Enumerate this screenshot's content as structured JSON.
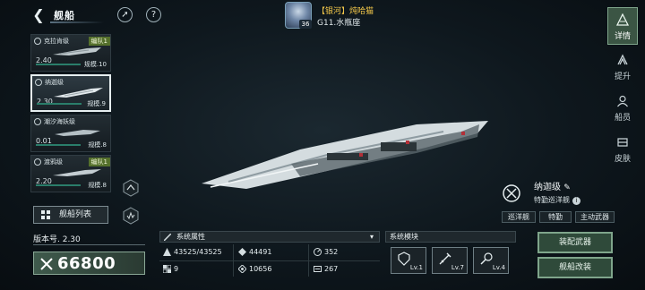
{
  "header": {
    "title": "舰船",
    "player_name": "【银河】炖哈猫",
    "player_location": "G11.水瓶座",
    "player_level": "36"
  },
  "right_nav": [
    {
      "label": "详情",
      "icon": "detail-icon",
      "active": true
    },
    {
      "label": "提升",
      "icon": "upgrade-icon",
      "active": false
    },
    {
      "label": "船员",
      "icon": "crew-icon",
      "active": false
    },
    {
      "label": "皮肤",
      "icon": "skin-icon",
      "active": false
    }
  ],
  "ship_list": [
    {
      "name": "克拉肯级",
      "tag": "编队1",
      "power": "2.40",
      "scale": "规模.10",
      "selected": false
    },
    {
      "name": "纳迦级",
      "tag": "",
      "power": "2.30",
      "scale": "规模.9",
      "selected": true
    },
    {
      "name": "潮汐海妖级",
      "tag": "",
      "power": "0.01",
      "scale": "规模.8",
      "selected": false
    },
    {
      "name": "渡鸦级",
      "tag": "编队1",
      "power": "2.20",
      "scale": "规模.8",
      "selected": false
    }
  ],
  "fleet_list_button": "舰船列表",
  "version": "版本号. 2.30",
  "combat_power": "66800",
  "ship_info": {
    "name": "纳迦级",
    "type": "特勤巡洋舰",
    "tags": [
      "巡洋舰",
      "特勤",
      "主动武器"
    ]
  },
  "stats": {
    "title": "系统属性",
    "items": [
      {
        "icon": "hull-icon",
        "value": "43525/43525"
      },
      {
        "icon": "attack-icon",
        "value": "44491"
      },
      {
        "icon": "speed-icon",
        "value": "352"
      },
      {
        "icon": "slot-icon",
        "value": "9"
      },
      {
        "icon": "armor-icon",
        "value": "10656"
      },
      {
        "icon": "cargo-icon",
        "value": "267"
      }
    ]
  },
  "modules": {
    "title": "系统模块",
    "items": [
      {
        "icon": "shield-module-icon",
        "level": "Lv.1"
      },
      {
        "icon": "weapon-module-icon",
        "level": "Lv.7"
      },
      {
        "icon": "support-module-icon",
        "level": "Lv.4"
      }
    ]
  },
  "actions": {
    "equip": "装配武器",
    "modify": "舰船改装"
  },
  "colors": {
    "accent_green": "#3b5544",
    "gold": "#f4c84a",
    "background": "#0b1217"
  }
}
